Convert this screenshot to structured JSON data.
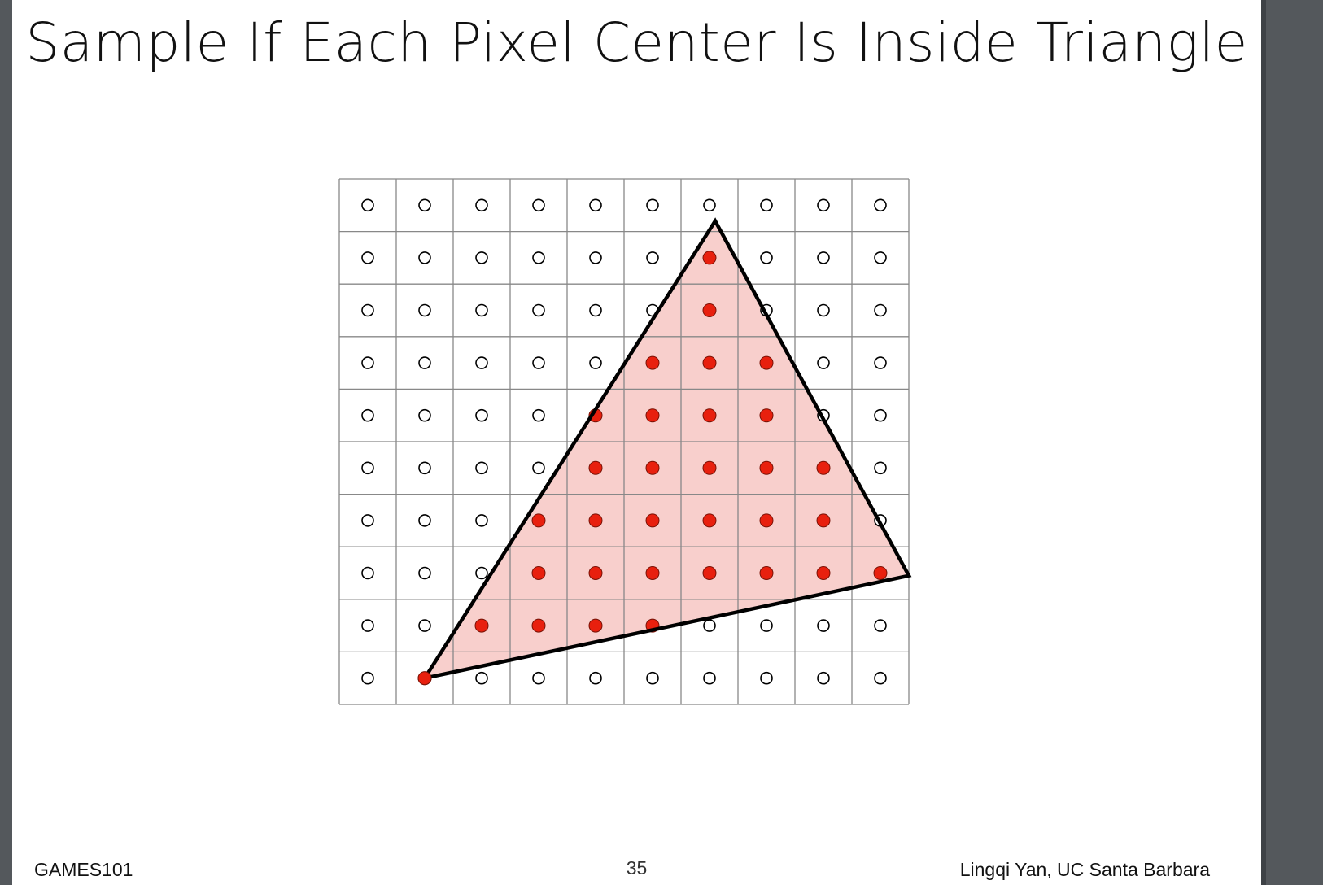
{
  "slide": {
    "title": "Sample If Each Pixel Center Is Inside Triangle",
    "footer_left": "GAMES101",
    "page_number": "35",
    "footer_right": "Lingqi Yan, UC Santa Barbara"
  },
  "figure": {
    "grid_columns": 10,
    "grid_rows": 10,
    "triangle_vertices": [
      [
        1.5,
        9.5
      ],
      [
        6.6,
        0.8
      ],
      [
        10.0,
        7.55
      ]
    ],
    "inside_samples": [
      [
        6,
        1
      ],
      [
        6,
        2
      ],
      [
        5,
        3
      ],
      [
        6,
        3
      ],
      [
        7,
        3
      ],
      [
        4,
        4
      ],
      [
        5,
        4
      ],
      [
        6,
        4
      ],
      [
        7,
        4
      ],
      [
        4,
        5
      ],
      [
        5,
        5
      ],
      [
        6,
        5
      ],
      [
        7,
        5
      ],
      [
        8,
        5
      ],
      [
        3,
        6
      ],
      [
        4,
        6
      ],
      [
        5,
        6
      ],
      [
        6,
        6
      ],
      [
        7,
        6
      ],
      [
        8,
        6
      ],
      [
        3,
        7
      ],
      [
        4,
        7
      ],
      [
        5,
        7
      ],
      [
        6,
        7
      ],
      [
        7,
        7
      ],
      [
        8,
        7
      ],
      [
        9,
        7
      ],
      [
        2,
        8
      ],
      [
        3,
        8
      ],
      [
        4,
        8
      ],
      [
        5,
        8
      ],
      [
        1,
        9
      ]
    ],
    "colors": {
      "triangle_fill": "#f8cfcc",
      "triangle_stroke": "#000000",
      "inside_sample": "#e8200e",
      "grid_line": "#888888",
      "outside_sample_stroke": "#000000"
    }
  }
}
